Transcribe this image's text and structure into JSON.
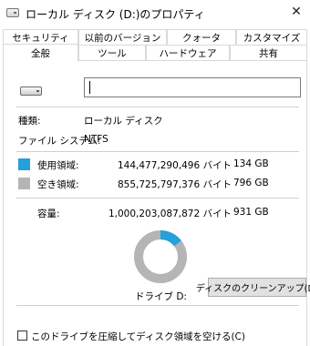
{
  "window": {
    "title": "ローカル ディスク (D:)のプロパティ",
    "close_glyph": "✕"
  },
  "tabs": {
    "row1": [
      "セキュリティ",
      "以前のバージョン",
      "クォータ",
      "カスタマイズ"
    ],
    "row2": [
      "全般",
      "ツール",
      "ハードウェア",
      "共有"
    ],
    "active": "全般"
  },
  "general": {
    "drive_name_value": "",
    "type_label": "種類:",
    "type_value": "ローカル ディスク",
    "fs_label": "ファイル システム:",
    "fs_value": "NTFS",
    "used_label": "使用領域:",
    "used_bytes": "144,477,290,496 バイト",
    "used_gb": "134 GB",
    "free_label": "空き領域:",
    "free_bytes": "855,725,797,376 バイト",
    "free_gb": "796 GB",
    "capacity_label": "容量:",
    "capacity_bytes": "1,000,203,087,872 バイト",
    "capacity_gb": "931 GB",
    "drive_label": "ドライブ D:",
    "cleanup_button": "ディスクのクリーンアップ(D)",
    "compress_label": "このドライブを圧縮してディスク領域を空ける(C)"
  },
  "usage": {
    "used_fraction": 0.1445
  },
  "colors": {
    "used": "#26a0da",
    "free": "#b5b5b5"
  },
  "icons": {
    "drive": "hard-drive-icon",
    "title": "hard-drive-icon",
    "close": "close-icon"
  }
}
